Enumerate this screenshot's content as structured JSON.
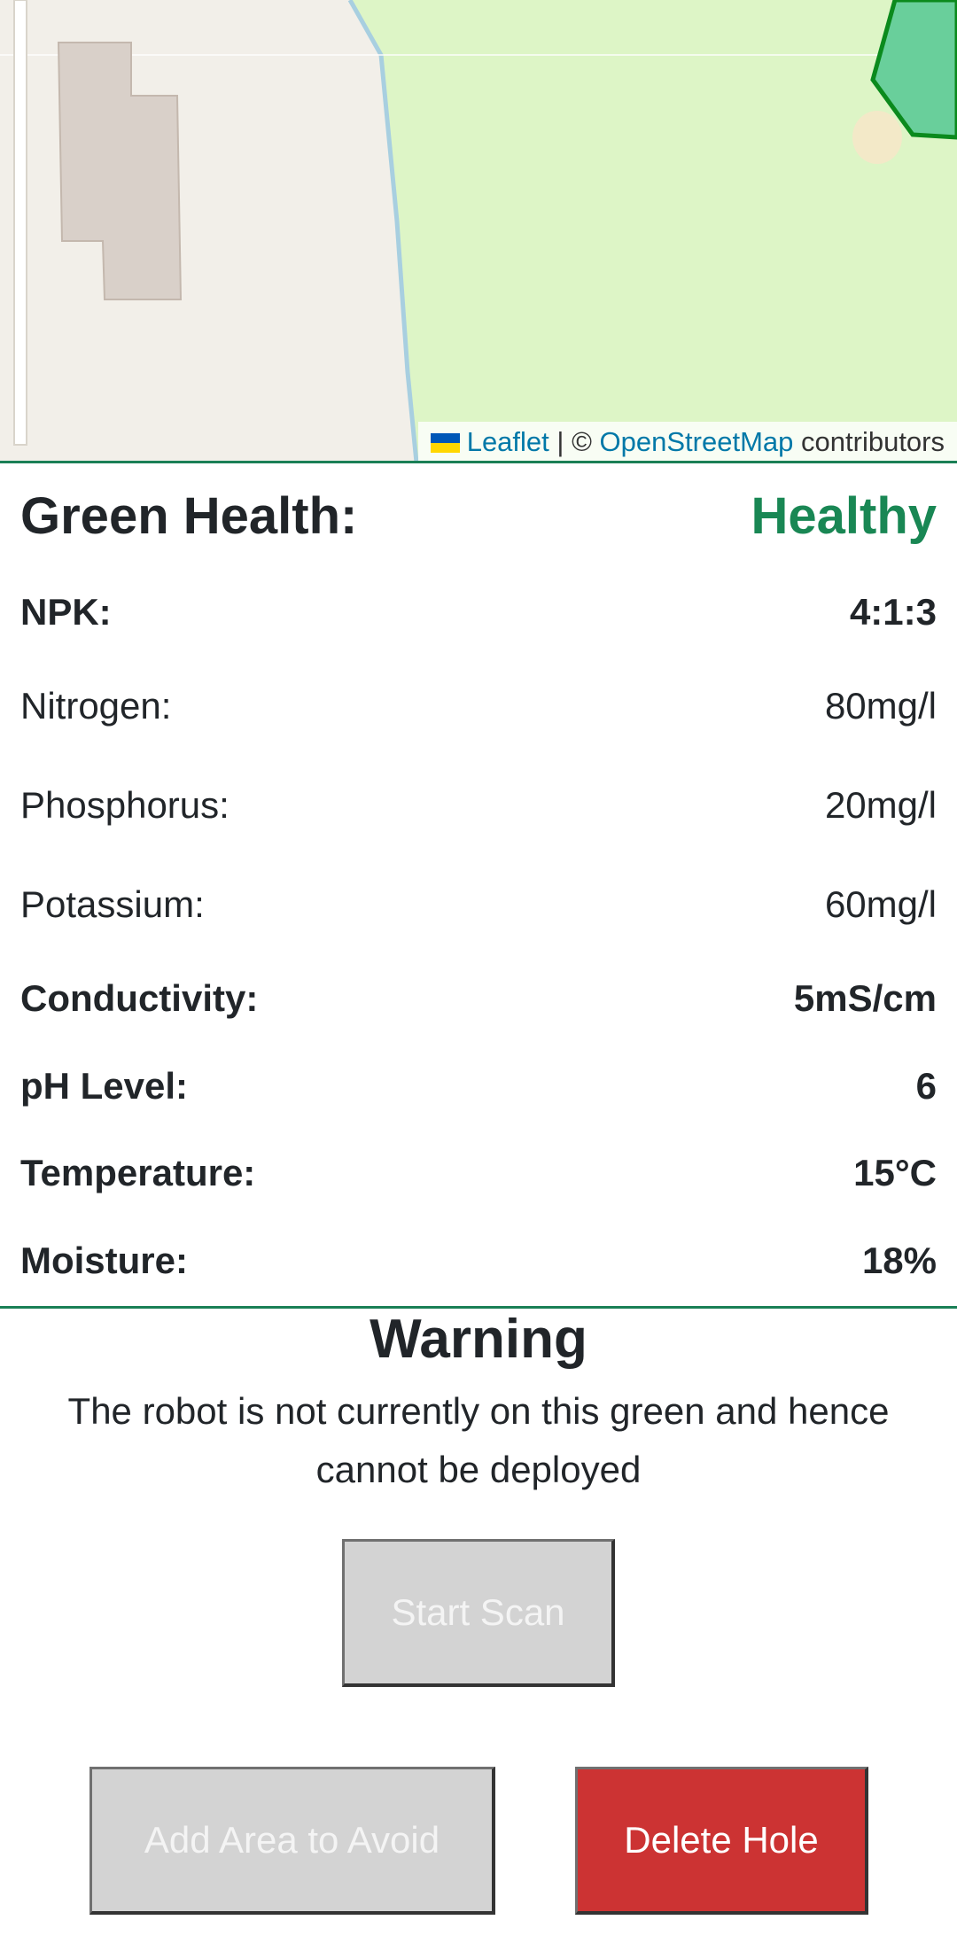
{
  "map": {
    "attribution": {
      "leaflet_link": "Leaflet",
      "separator": "| ©",
      "osm_link": "OpenStreetMap",
      "suffix": "contributors"
    }
  },
  "green_health": {
    "label": "Green Health:",
    "value": "Healthy",
    "value_color": "#198754"
  },
  "metrics": [
    {
      "label": "NPK:",
      "value": "4:1:3"
    },
    {
      "label": "Nitrogen:",
      "value": "80mg/l"
    },
    {
      "label": "Phosphorus:",
      "value": "20mg/l"
    },
    {
      "label": "Potassium:",
      "value": "60mg/l"
    },
    {
      "label": "Conductivity:",
      "value": "5mS/cm"
    },
    {
      "label": "pH Level:",
      "value": "6"
    },
    {
      "label": "Temperature:",
      "value": "15°C"
    },
    {
      "label": "Moisture:",
      "value": "18%"
    }
  ],
  "warning": {
    "title": "Warning",
    "message": "The robot is not currently on this green and hence cannot be deployed"
  },
  "buttons": {
    "start_scan": "Start Scan",
    "add_area": "Add Area to Avoid",
    "delete_hole": "Delete Hole"
  },
  "colors": {
    "accent": "#1a7f56",
    "danger": "#cc3333",
    "disabled": "#d3d3d3"
  }
}
